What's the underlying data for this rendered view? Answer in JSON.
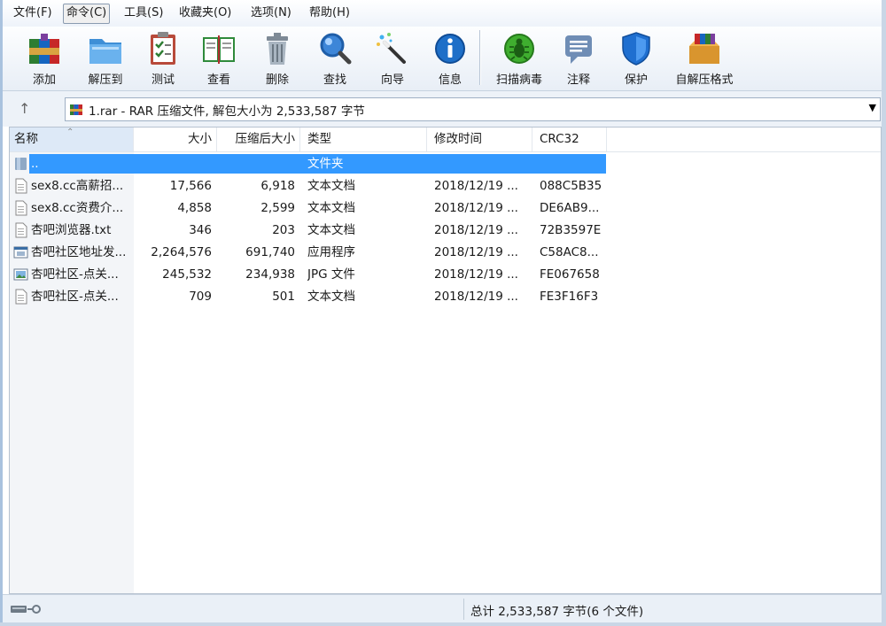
{
  "menu": [
    "文件(F)",
    "命令(C)",
    "工具(S)",
    "收藏夹(O)",
    "选项(N)",
    "帮助(H)"
  ],
  "toolbar": [
    {
      "label": "添加",
      "icon": "add-archive-icon"
    },
    {
      "label": "解压到",
      "icon": "extract-to-icon"
    },
    {
      "label": "测试",
      "icon": "test-clipboard-icon"
    },
    {
      "label": "查看",
      "icon": "view-book-icon"
    },
    {
      "label": "删除",
      "icon": "trash-can-icon"
    },
    {
      "label": "查找",
      "icon": "magnifier-icon"
    },
    {
      "label": "向导",
      "icon": "wizard-wand-icon"
    },
    {
      "label": "信息",
      "icon": "info-icon"
    },
    {
      "label": "扫描病毒",
      "icon": "virus-scan-icon"
    },
    {
      "label": "注释",
      "icon": "comment-icon"
    },
    {
      "label": "保护",
      "icon": "shield-icon"
    },
    {
      "label": "自解压格式",
      "icon": "sfx-box-icon"
    }
  ],
  "address": {
    "text": "1.rar - RAR 压缩文件, 解包大小为 2,533,587 字节"
  },
  "columns": [
    "名称",
    "大小",
    "压缩后大小",
    "类型",
    "修改时间",
    "CRC32"
  ],
  "rows": [
    {
      "name": "..",
      "size": "",
      "packed": "",
      "type": "文件夹",
      "modified": "",
      "crc": "",
      "icon": "parent-folder-icon",
      "selected": true
    },
    {
      "name": "sex8.cc高薪招...",
      "size": "17,566",
      "packed": "6,918",
      "type": "文本文档",
      "modified": "2018/12/19 ...",
      "crc": "088C5B35",
      "icon": "text-file-icon"
    },
    {
      "name": "sex8.cc资费介...",
      "size": "4,858",
      "packed": "2,599",
      "type": "文本文档",
      "modified": "2018/12/19 ...",
      "crc": "DE6AB9...",
      "icon": "text-file-icon"
    },
    {
      "name": "杏吧浏览器.txt",
      "size": "346",
      "packed": "203",
      "type": "文本文档",
      "modified": "2018/12/19 ...",
      "crc": "72B3597E",
      "icon": "text-file-icon"
    },
    {
      "name": "杏吧社区地址发...",
      "size": "2,264,576",
      "packed": "691,740",
      "type": "应用程序",
      "modified": "2018/12/19 ...",
      "crc": "C58AC8...",
      "icon": "application-icon"
    },
    {
      "name": "杏吧社区-点关...",
      "size": "245,532",
      "packed": "234,938",
      "type": "JPG 文件",
      "modified": "2018/12/19 ...",
      "crc": "FE067658",
      "icon": "image-file-icon"
    },
    {
      "name": "杏吧社区-点关...",
      "size": "709",
      "packed": "501",
      "type": "文本文档",
      "modified": "2018/12/19 ...",
      "crc": "FE3F16F3",
      "icon": "text-file-icon"
    }
  ],
  "status": {
    "text": "总计 2,533,587 字节(6 个文件)"
  },
  "colors": {
    "selection": "#3399ff",
    "toolbar_bg": "#e8eef6"
  }
}
